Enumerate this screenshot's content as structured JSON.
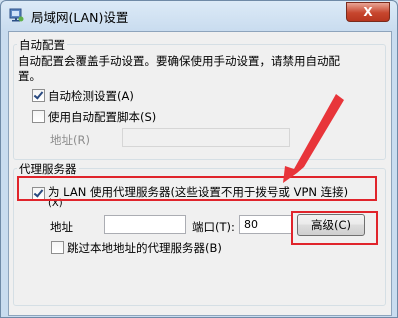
{
  "window": {
    "title": "局域网(LAN)设置",
    "close_label": "X"
  },
  "auto_config": {
    "group_label": "自动配置",
    "description_line1": "自动配置会覆盖手动设置。要确保使用手动设置，请禁用自动配",
    "description_line2": "置。",
    "auto_detect": {
      "label": "自动检测设置(A)",
      "checked": true
    },
    "use_script": {
      "label": "使用自动配置脚本(S)",
      "checked": false
    },
    "address_label": "地址(R)",
    "address_value": ""
  },
  "proxy": {
    "group_label": "代理服务器",
    "use_proxy_label": "为 LAN 使用代理服务器(这些设置不用于拨号或 VPN 连接)",
    "use_proxy_label_line2": "(X)",
    "use_proxy_checked": true,
    "address_label": "地址",
    "address_value": "",
    "port_label": "端口(T):",
    "port_value": "80",
    "advanced_label": "高级(C)",
    "bypass_local": {
      "label": "跳过本地地址的代理服务器(B)",
      "checked": false
    }
  },
  "colors": {
    "highlight": "#e0242b",
    "arrow": "#e8353a"
  }
}
